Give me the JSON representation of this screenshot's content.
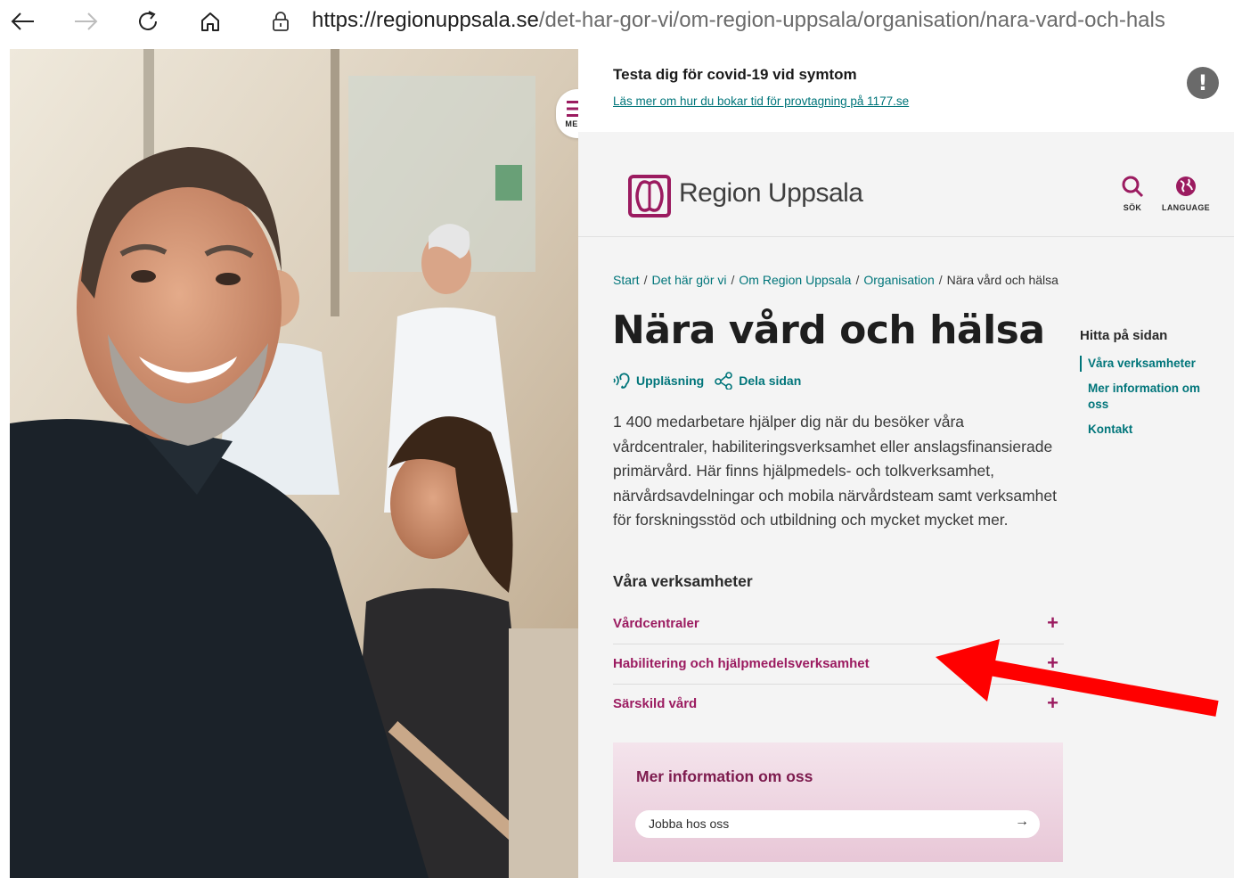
{
  "browser": {
    "url_domain": "https://regionuppsala.se",
    "url_path": "/det-har-gor-vi/om-region-uppsala/organisation/nara-vard-och-hals"
  },
  "alert": {
    "title": "Testa dig för covid-19 vid symtom",
    "link": "Läs mer om hur du bokar tid för provtagning på 1177.se",
    "icon_glyph": "!"
  },
  "menu": {
    "label": "MENY"
  },
  "header": {
    "logo_text": "Region Uppsala",
    "search_label": "SÖK",
    "language_label": "LANGUAGE"
  },
  "breadcrumb": [
    {
      "label": "Start"
    },
    {
      "label": "Det här gör vi"
    },
    {
      "label": "Om Region Uppsala"
    },
    {
      "label": "Organisation"
    },
    {
      "label": "Nära vård och hälsa"
    }
  ],
  "page": {
    "title": "Nära vård och hälsa",
    "listen_label": "Uppläsning",
    "share_label": "Dela sidan",
    "intro": "1 400 medarbetare hjälper dig när du besöker våra vårdcentraler, habiliteringsverksamhet eller anslagsfinansierade primärvård. Här finns hjälpmedels- och tolkverksamhet, närvårdsavdelningar och mobila närvårdsteam samt verksamhet för forskningsstöd och utbildning och mycket mycket mer.",
    "section_title": "Våra verksamheter"
  },
  "accordion": [
    {
      "label": "Vårdcentraler",
      "icon": "+"
    },
    {
      "label": "Habilitering och hjälpmedelsverksamhet",
      "icon": "+"
    },
    {
      "label": "Särskild vård",
      "icon": "+"
    }
  ],
  "info_box": {
    "title": "Mer information om oss",
    "link_label": "Jobba hos oss",
    "link_arrow": "→"
  },
  "toc": {
    "title": "Hitta på sidan",
    "items": [
      "Våra verksamheter",
      "Mer information om oss",
      "Kontakt"
    ]
  },
  "colors": {
    "brand": "#9b1b60",
    "link": "#00757a",
    "arrow": "#ff0000"
  }
}
